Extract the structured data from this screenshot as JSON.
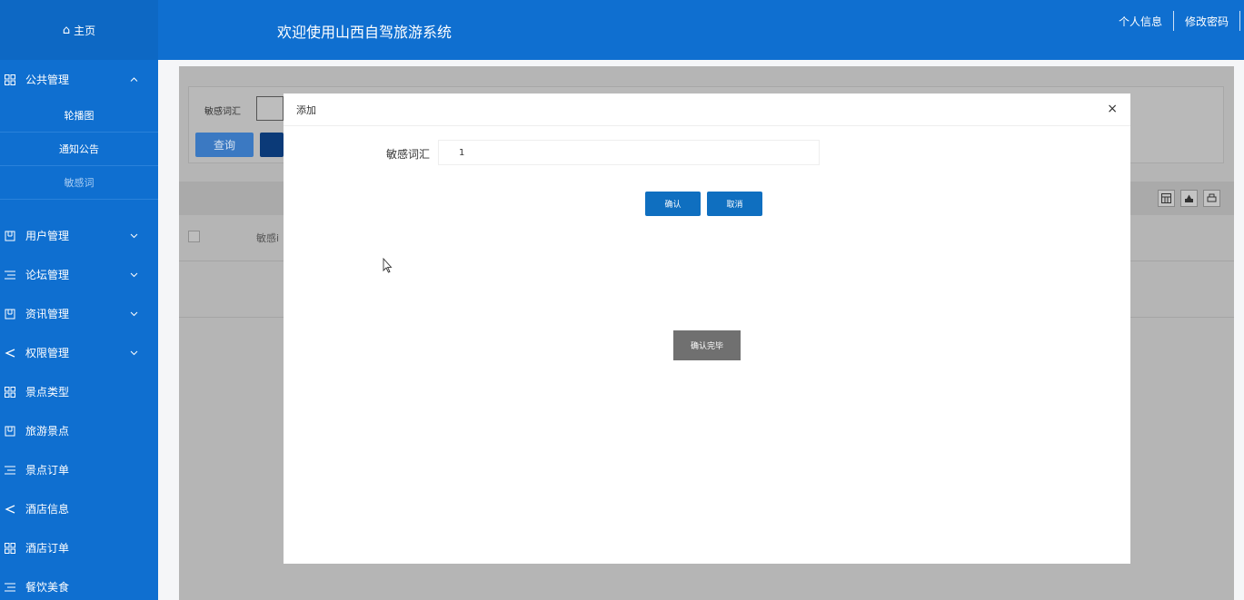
{
  "sidebar": {
    "home_icon": "⌂",
    "home_label": "主页",
    "groups": [
      {
        "label": "公共管理",
        "icon": "grid-icon",
        "arrow": "^"
      },
      {
        "label": "用户管理",
        "icon": "book-icon",
        "arrow": "v"
      },
      {
        "label": "论坛管理",
        "icon": "list-icon",
        "arrow": "v"
      },
      {
        "label": "资讯管理",
        "icon": "book-icon",
        "arrow": "v"
      },
      {
        "label": "权限管理",
        "icon": "share-icon",
        "arrow": "v"
      },
      {
        "label": "景点类型",
        "icon": "grid-icon"
      },
      {
        "label": "旅游景点",
        "icon": "book-icon"
      },
      {
        "label": "景点订单",
        "icon": "list-icon"
      },
      {
        "label": "酒店信息",
        "icon": "share-icon"
      },
      {
        "label": "酒店订单",
        "icon": "grid-icon"
      },
      {
        "label": "餐饮美食",
        "icon": "list-icon"
      }
    ],
    "submenu": [
      "轮播图",
      "通知公告",
      "敏感词"
    ]
  },
  "header": {
    "title": "欢迎使用山西自驾旅游系统",
    "link_profile": "个人信息",
    "link_password": "修改密码"
  },
  "search": {
    "label": "敏感词汇",
    "query_button": "查询"
  },
  "table": {
    "col_header": "敏感i"
  },
  "modal": {
    "title": "添加",
    "close": "×",
    "field_label": "敏感词汇",
    "field_value": "1",
    "confirm": "确认",
    "cancel": "取消",
    "done": "确认完毕"
  },
  "colors": {
    "primary": "#0f6fd0",
    "button": "#0f6fc0",
    "overlay": "#b5b5b5",
    "done_button": "#707070"
  }
}
